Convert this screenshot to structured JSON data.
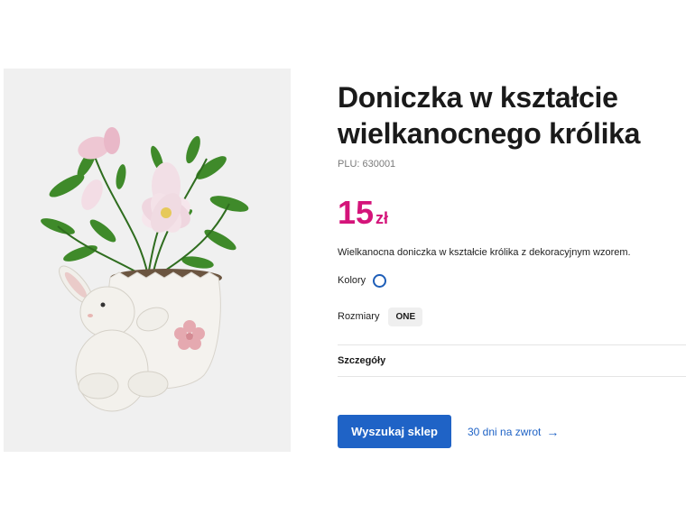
{
  "product": {
    "title_line1": "Doniczka w kształcie",
    "title_line2": "wielkanocnego królika",
    "plu_label": "PLU:",
    "plu_value": "630001",
    "price_amount": "15",
    "price_currency": "zł",
    "description": "Wielkanocna doniczka w kształcie królika z dekoracyjnym wzorem.",
    "image_alt": "rabbit-pot-with-flowers-image"
  },
  "options": {
    "colors_label": "Kolory",
    "sizes_label": "Rozmiary",
    "selected_size": "ONE"
  },
  "details": {
    "label": "Szczegóły"
  },
  "actions": {
    "find_store_label": "Wyszukaj sklep",
    "returns_label": "30 dni na zwrot",
    "returns_arrow": "→"
  },
  "colors": {
    "price": "#d4147a",
    "primary_button": "#1f63c6",
    "link": "#1f63c6",
    "swatch_border": "#1e5eb8",
    "image_background": "#f0f0f0"
  }
}
